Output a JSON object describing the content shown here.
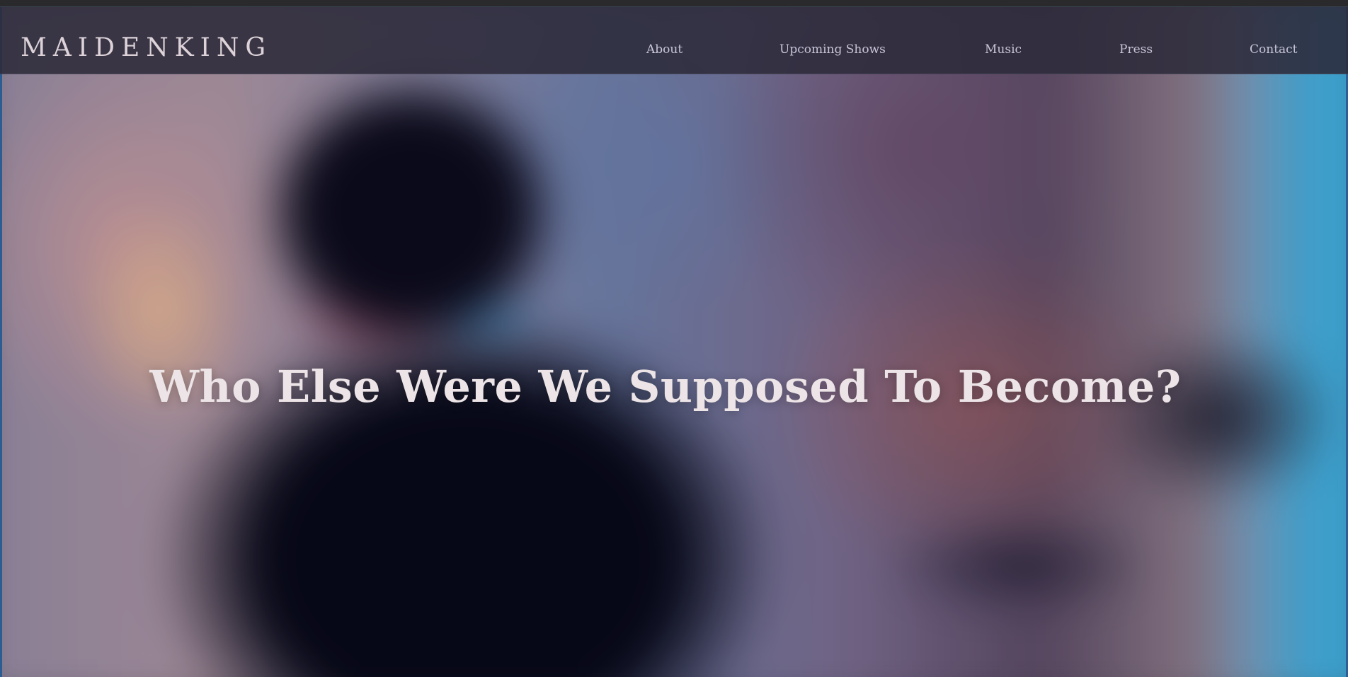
{
  "site": {
    "logo_text": "MAIDENKING"
  },
  "nav": {
    "items": [
      {
        "label": "About"
      },
      {
        "label": "Upcoming Shows"
      },
      {
        "label": "Music"
      },
      {
        "label": "Press"
      },
      {
        "label": "Contact"
      }
    ]
  },
  "hero": {
    "headline": "Who Else Were We Supposed To Become?",
    "background_image": "blurred-musician-photo"
  },
  "colors": {
    "nav_background": "#2c2a3a",
    "logo_text": "#dcd2d8",
    "nav_text": "#c9c5d8",
    "headline_text": "#ece4e6",
    "accent_blue": "#43b6e6"
  }
}
